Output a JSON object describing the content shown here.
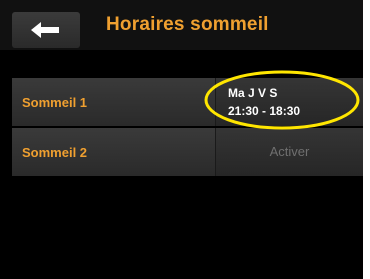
{
  "header": {
    "back_icon": "back-arrow-icon",
    "title": "Horaires sommeil"
  },
  "sleep_schedules": [
    {
      "label": "Sommeil 1",
      "days": "Ma J V S",
      "time": "21:30 - 18:30"
    },
    {
      "label": "Sommeil 2",
      "action": "Activer"
    }
  ],
  "colors": {
    "accent": "#f0a030",
    "annotation": "#ffe600",
    "background": "#000000",
    "inactive_text": "#6f6f6f"
  }
}
